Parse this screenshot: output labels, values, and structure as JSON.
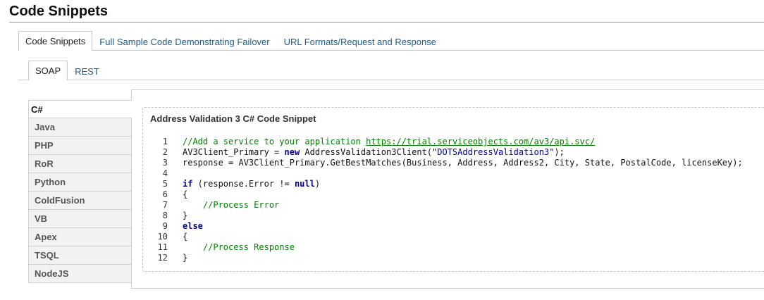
{
  "page": {
    "title": "Code Snippets"
  },
  "main_tabs": [
    {
      "label": "Code Snippets",
      "active": true
    },
    {
      "label": "Full Sample Code Demonstrating Failover",
      "active": false
    },
    {
      "label": "URL Formats/Request and Response",
      "active": false
    }
  ],
  "sub_tabs": [
    {
      "label": "SOAP",
      "active": true
    },
    {
      "label": "REST",
      "active": false
    }
  ],
  "languages": [
    {
      "label": "C#",
      "active": true
    },
    {
      "label": "Java",
      "active": false
    },
    {
      "label": "PHP",
      "active": false
    },
    {
      "label": "RoR",
      "active": false
    },
    {
      "label": "Python",
      "active": false
    },
    {
      "label": "ColdFusion",
      "active": false
    },
    {
      "label": "VB",
      "active": false
    },
    {
      "label": "Apex",
      "active": false
    },
    {
      "label": "TSQL",
      "active": false
    },
    {
      "label": "NodeJS",
      "active": false
    }
  ],
  "snippet": {
    "title": "Address Validation 3 C# Code Snippet",
    "lines": [
      [
        {
          "t": "//Add a service to your application ",
          "c": "cm"
        },
        {
          "t": "https://trial.serviceobjects.com/av3/api.svc/",
          "c": "lnk"
        }
      ],
      [
        {
          "t": "AV3Client_Primary = "
        },
        {
          "t": "new",
          "c": "kw"
        },
        {
          "t": " AddressValidation3Client("
        },
        {
          "t": "\"DOTSAddressValidation3\"",
          "c": "str"
        },
        {
          "t": ");"
        }
      ],
      [
        {
          "t": "response = AV3Client_Primary.GetBestMatches(Business, Address, Address2, City, State, PostalCode, licenseKey);"
        }
      ],
      [],
      [
        {
          "t": "if",
          "c": "kw"
        },
        {
          "t": " (response.Error != "
        },
        {
          "t": "null",
          "c": "kw"
        },
        {
          "t": ")"
        }
      ],
      [
        {
          "t": "{"
        }
      ],
      [
        {
          "t": "    "
        },
        {
          "t": "//Process Error",
          "c": "cm"
        }
      ],
      [
        {
          "t": "}"
        }
      ],
      [
        {
          "t": "else",
          "c": "kw"
        }
      ],
      [
        {
          "t": "{"
        }
      ],
      [
        {
          "t": "    "
        },
        {
          "t": "//Process Response",
          "c": "cm"
        }
      ],
      [
        {
          "t": "}"
        }
      ]
    ]
  }
}
